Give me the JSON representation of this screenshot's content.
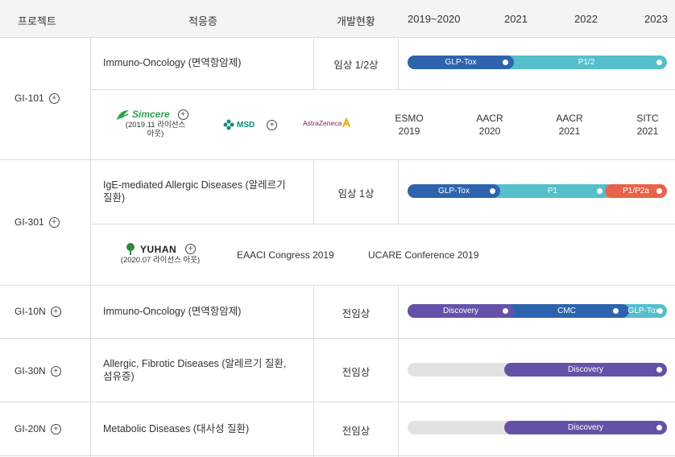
{
  "header": {
    "project": "프로젝트",
    "indication": "적응증",
    "status": "개발현황",
    "y1": "2019~2020",
    "y2": "2021",
    "y3": "2022",
    "y4": "2023"
  },
  "rows": {
    "gi101": {
      "name": "GI-101",
      "indication": "Immuno-Oncology (면역항암제)",
      "status": "임상 1/2상",
      "segs": [
        "GLP-Tox",
        "P1/2"
      ],
      "partners": {
        "simcere": "Simcere",
        "simcere_note1": "(2019.11 라이선스",
        "simcere_note2": "아웃)",
        "msd": "MSD",
        "az": "AstraZeneca"
      },
      "conferences": [
        {
          "name": "ESMO",
          "year": "2019"
        },
        {
          "name": "AACR",
          "year": "2020"
        },
        {
          "name": "AACR",
          "year": "2021"
        },
        {
          "name": "SITC",
          "year": "2021"
        }
      ]
    },
    "gi301": {
      "name": "GI-301",
      "indication_l1": "IgE-mediated Allergic Diseases (알레르기",
      "indication_l2": "질환)",
      "status": "임상 1상",
      "segs": [
        "GLP-Tox",
        "P1",
        "P1/P2a"
      ],
      "partner": "YUHAN",
      "partner_note": "(2020.07 라이선스 아웃)",
      "conferences": [
        "EAACI Congress 2019",
        "UCARE Conference 2019"
      ]
    },
    "gi10n": {
      "name": "GI-10N",
      "indication": "Immuno-Oncology (면역항암제)",
      "status": "전임상",
      "segs": [
        "Discovery",
        "CMC",
        "GLP-Tox"
      ]
    },
    "gi30n": {
      "name": "GI-30N",
      "indication_l1": "Allergic, Fibrotic Diseases (알레르기 질환,",
      "indication_l2": "섬유증)",
      "status": "전임상",
      "segs": [
        "Discovery"
      ]
    },
    "gi20n": {
      "name": "GI-20N",
      "indication": "Metabolic Diseases (대사성 질환)",
      "status": "전임상",
      "segs": [
        "Discovery"
      ]
    }
  },
  "colors": {
    "navy": "#2e64ad",
    "teal": "#55bfcb",
    "coral": "#e8634a",
    "purple": "#6552a8",
    "gray": "#e2e2e2"
  }
}
